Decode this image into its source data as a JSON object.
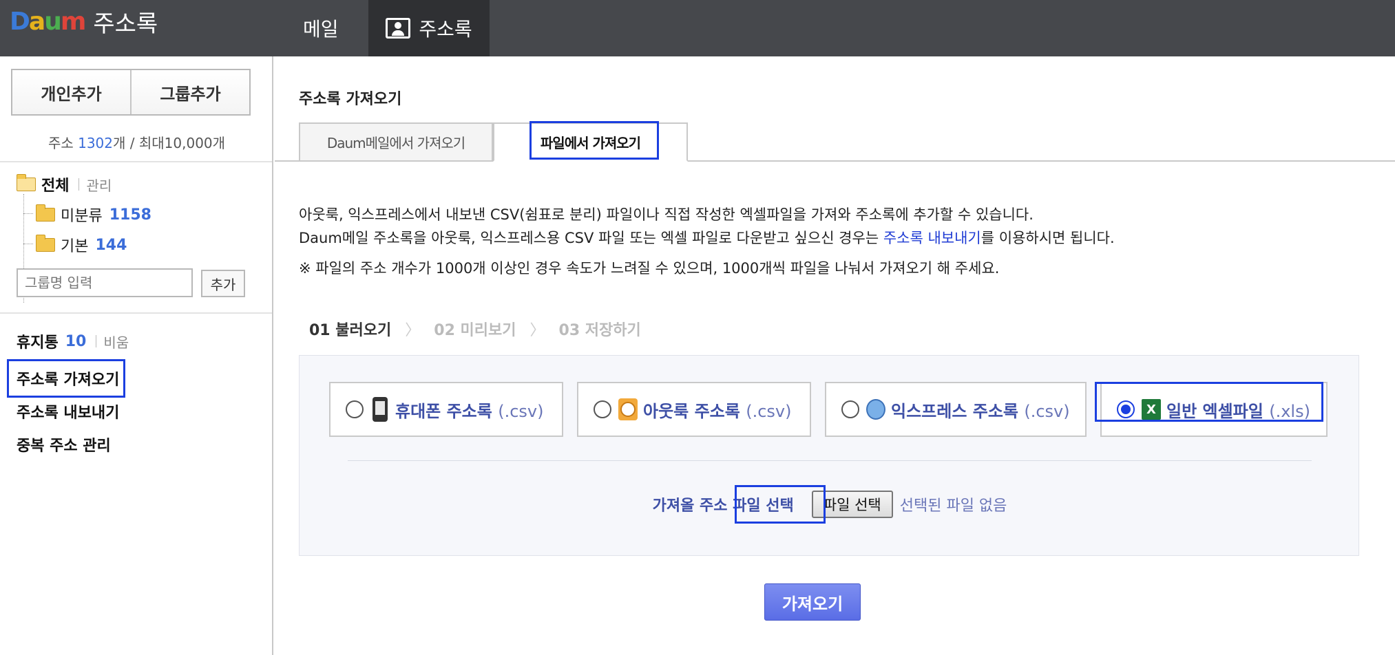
{
  "top_bar": {
    "logo": "Daum",
    "app_title": "주소록",
    "tabs": [
      {
        "label": "메일"
      },
      {
        "label": "주소록",
        "icon": "address-book-icon",
        "active": true
      }
    ]
  },
  "sidebar": {
    "add_person": "개인추가",
    "add_group": "그룹추가",
    "quota": {
      "prefix": "주소 ",
      "count": "1302",
      "suffix": "개 / 최대10,000개"
    },
    "tree": {
      "root_label": "전체",
      "manage_link": "관리",
      "items": [
        {
          "label": "미분류",
          "count": "1158"
        },
        {
          "label": "기본",
          "count": "144"
        }
      ]
    },
    "group_input_placeholder": "그룹명 입력",
    "group_add_button": "추가",
    "trash": {
      "label": "휴지통",
      "count": "10",
      "empty_link": "비움"
    },
    "links": [
      {
        "label": "주소록 가져오기",
        "active": true
      },
      {
        "label": "주소록 내보내기"
      },
      {
        "label": "중복 주소 관리"
      }
    ]
  },
  "main": {
    "title": "주소록 가져오기",
    "tabs": [
      {
        "label": "Daum메일에서 가져오기",
        "active": false
      },
      {
        "label": "파일에서 가져오기",
        "active": true
      }
    ],
    "description": {
      "line1": "아웃룩, 익스프레스에서 내보낸 CSV(쉼표로 분리) 파일이나 직접 작성한 엑셀파일을 가져와 주소록에 추가할 수 있습니다.",
      "line2_before": "Daum메일 주소록을 아웃룩, 익스프레스용 CSV 파일 또는 엑셀 파일로 다운받고 싶으신 경우는 ",
      "line2_link": "주소록 내보내기",
      "line2_after": "를 이용하시면 됩니다.",
      "note": "※ 파일의 주소 개수가 1000개 이상인 경우 속도가 느려질 수 있으며, 1000개씩 파일을 나눠서 가져오기 해 주세요."
    },
    "steps": [
      {
        "label": "01 불러오기",
        "current": true
      },
      {
        "label": "02 미리보기",
        "current": false
      },
      {
        "label": "03 저장하기",
        "current": false
      }
    ],
    "file_types": [
      {
        "label": "휴대폰 주소록",
        "ext": "(.csv)",
        "icon": "phone-icon",
        "selected": false
      },
      {
        "label": "아웃룩 주소록",
        "ext": "(.csv)",
        "icon": "outlook-icon",
        "selected": false
      },
      {
        "label": "익스프레스 주소록",
        "ext": "(.csv)",
        "icon": "express-icon",
        "selected": false
      },
      {
        "label": "일반 엑셀파일",
        "ext": "(.xls)",
        "icon": "excel-icon",
        "selected": true
      }
    ],
    "file_select": {
      "label": "가져올 주소 파일 선택",
      "button": "파일 선택",
      "status": "선택된 파일 없음"
    },
    "submit_button": "가져오기"
  },
  "colors": {
    "topbar_bg": "#46484c",
    "accent_blue": "#3b6dd9",
    "highlight_box": "#1b3fe0",
    "submit_button": "#5a6de6"
  }
}
